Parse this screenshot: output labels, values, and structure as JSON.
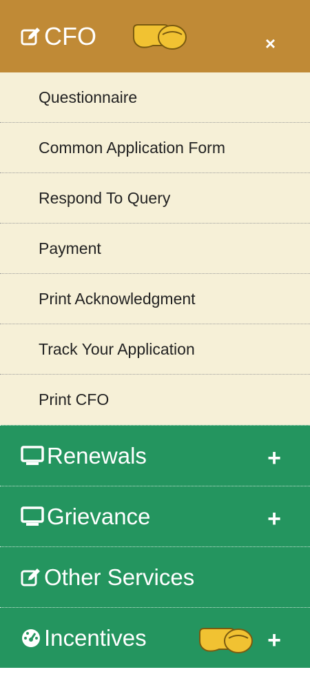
{
  "header": {
    "title": "CFO",
    "close_label": "×",
    "colors": {
      "background": "#c08a36",
      "text": "#ffffff"
    }
  },
  "submenu": {
    "items": [
      {
        "label": "Questionnaire"
      },
      {
        "label": "Common Application Form"
      },
      {
        "label": "Respond To Query"
      },
      {
        "label": "Payment"
      },
      {
        "label": "Print Acknowledgment"
      },
      {
        "label": "Track Your Application"
      },
      {
        "label": "Print CFO"
      }
    ],
    "colors": {
      "background": "#f6f0d7",
      "text": "#222222"
    }
  },
  "main_items": [
    {
      "label": "Renewals",
      "icon": "monitor-icon",
      "toggle": "+"
    },
    {
      "label": "Grievance",
      "icon": "monitor-icon",
      "toggle": "+"
    },
    {
      "label": "Other Services",
      "icon": "edit-icon"
    },
    {
      "label": "Incentives",
      "icon": "dashboard-icon",
      "toggle": "+",
      "pointer_icon": "pointing-hand-icon"
    }
  ],
  "colors": {
    "green": "#24955f"
  }
}
